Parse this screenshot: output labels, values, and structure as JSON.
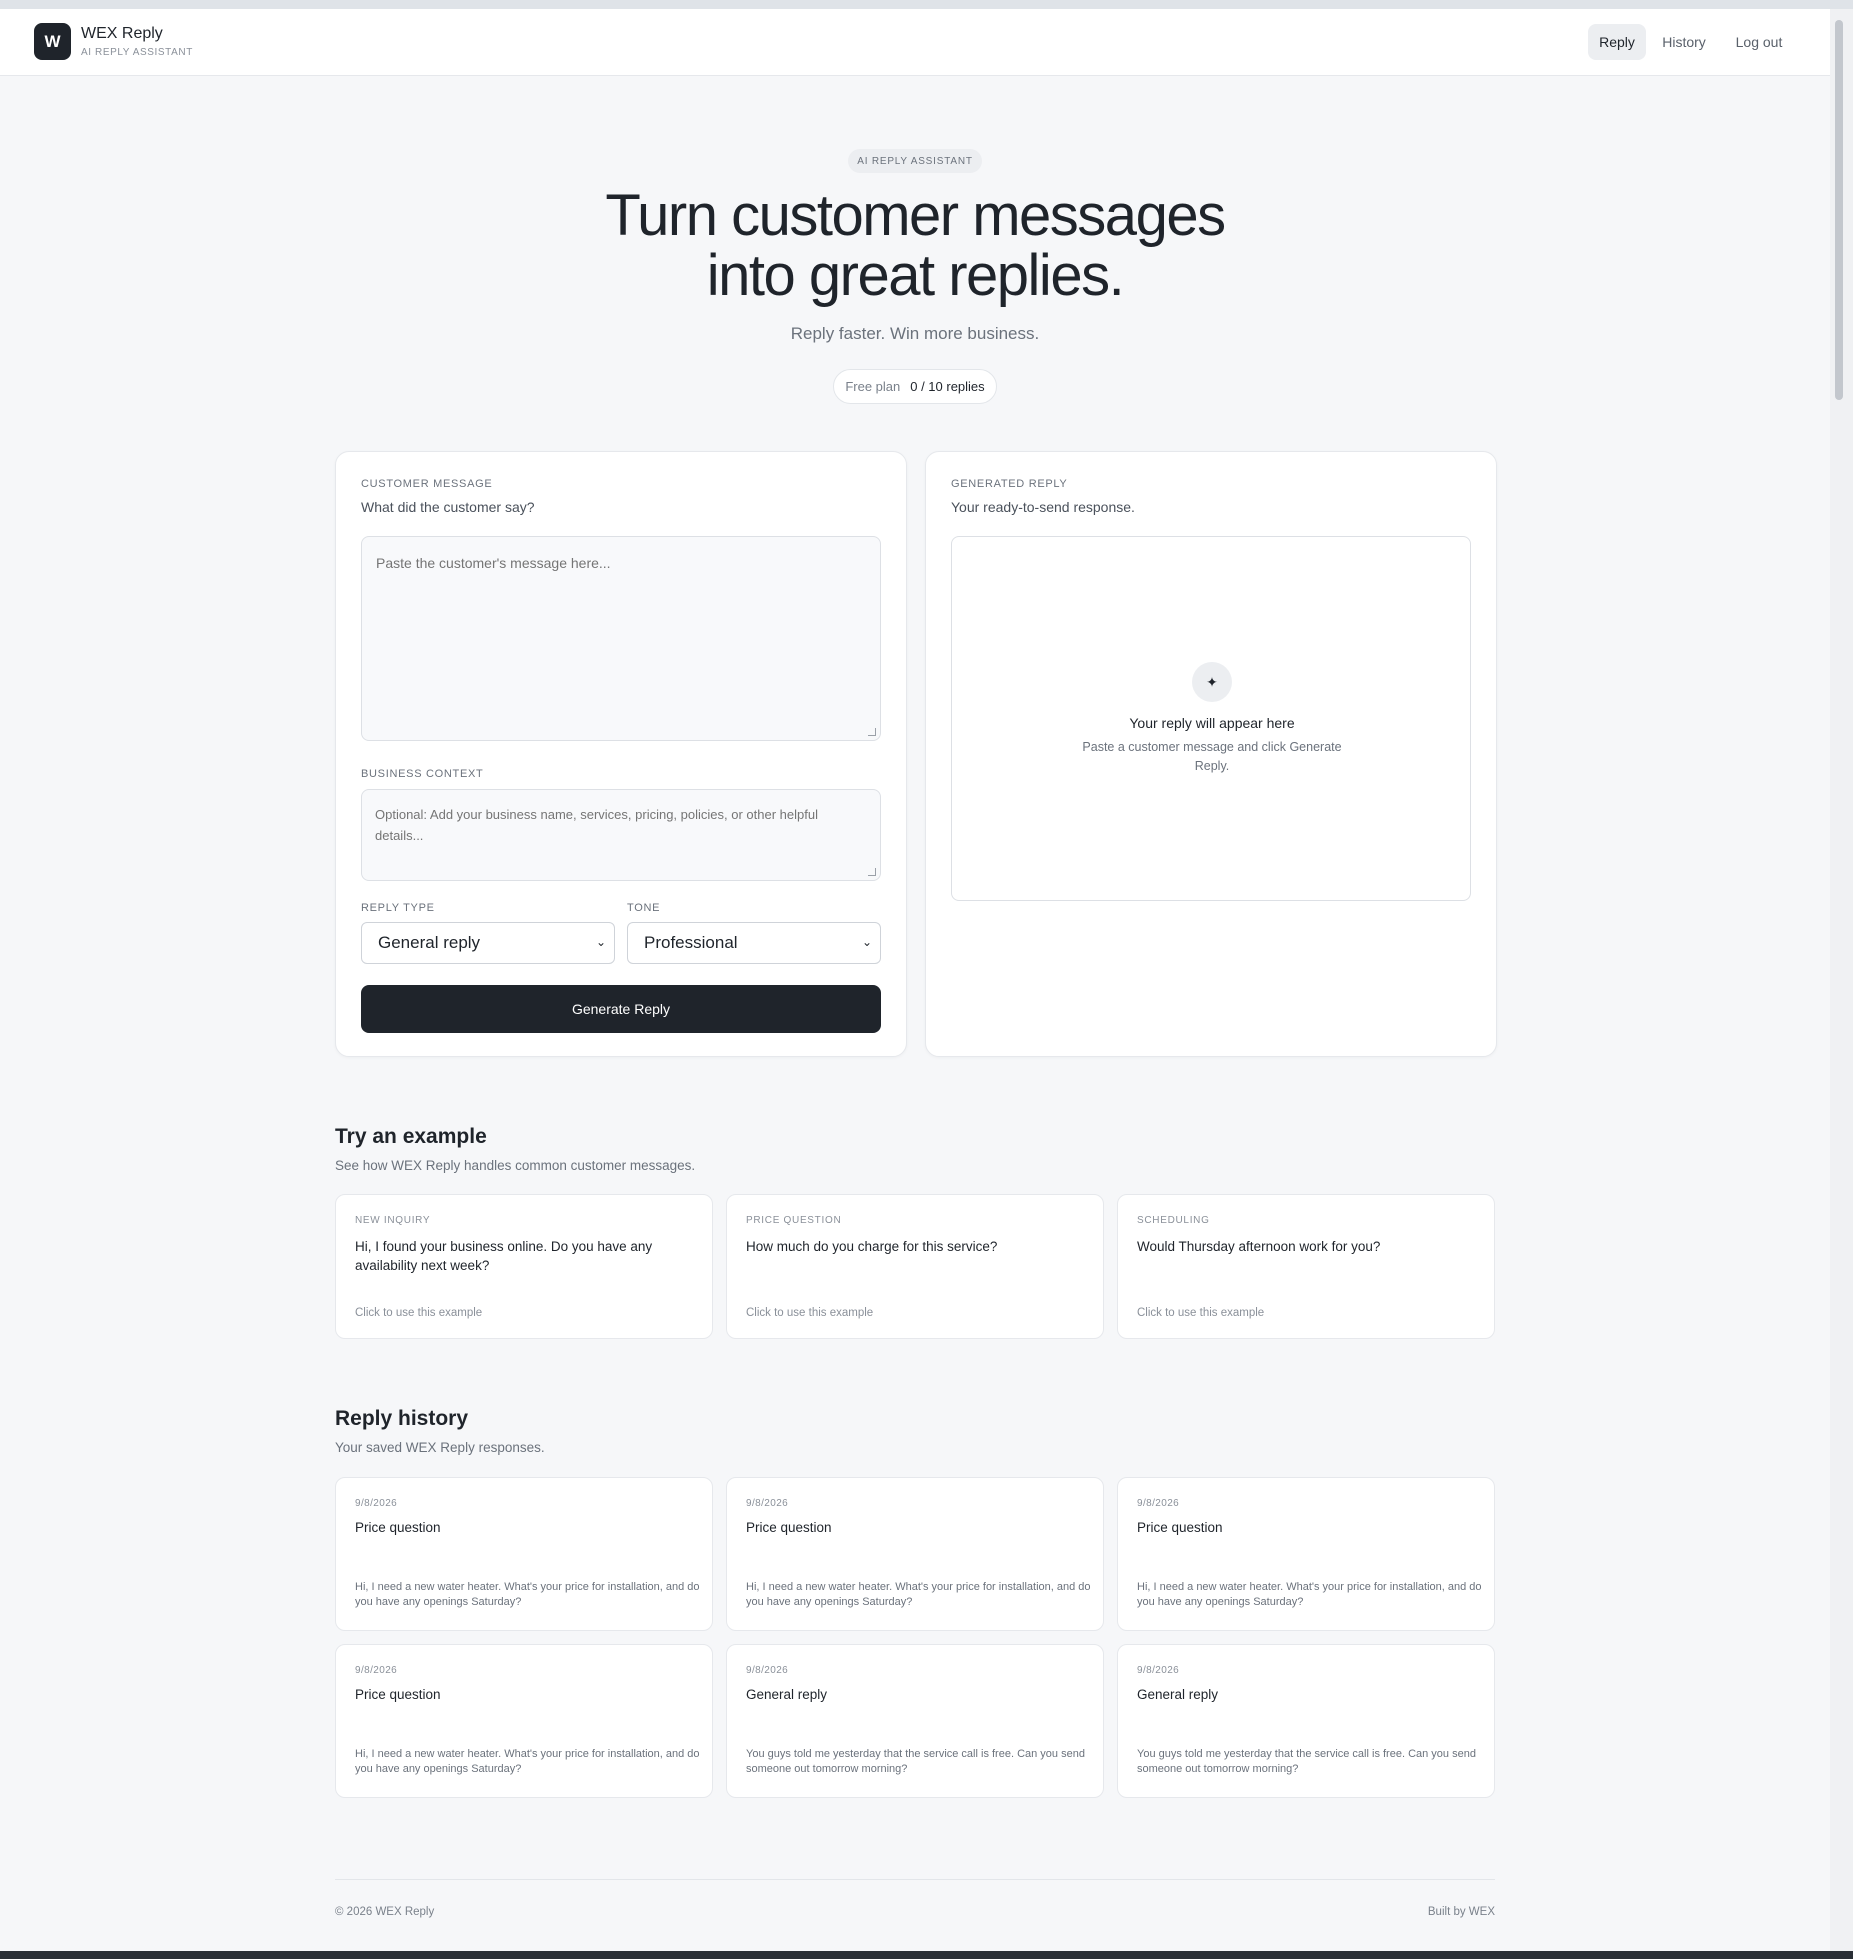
{
  "nav": {
    "logo_letter": "W",
    "brand_name": "WEX Reply",
    "brand_tagline": "AI REPLY ASSISTANT",
    "items": [
      {
        "label": "Reply",
        "active": true
      },
      {
        "label": "History",
        "active": false
      },
      {
        "label": "Log out",
        "active": false
      }
    ]
  },
  "hero": {
    "badge": "AI REPLY ASSISTANT",
    "title_line1": "Turn customer messages",
    "title_line2": "into great replies.",
    "subtitle": "Reply faster. Win more business.",
    "plan_label": "Free plan",
    "plan_count": "0 / 10 replies"
  },
  "composer": {
    "section_label": "CUSTOMER MESSAGE",
    "section_help": "What did the customer say?",
    "message_placeholder": "Paste the customer's message here...",
    "context_label": "BUSINESS CONTEXT",
    "context_placeholder": "Optional: Add your business name, services, pricing, policies, or other helpful details...",
    "reply_type_label": "REPLY TYPE",
    "reply_type_value": "General reply",
    "tone_label": "TONE",
    "tone_value": "Professional",
    "generate_label": "Generate Reply"
  },
  "output": {
    "section_label": "GENERATED REPLY",
    "section_help": "Your ready-to-send response.",
    "icon": "sparkle-icon",
    "empty_title": "Your reply will appear here",
    "empty_sub": "Paste a customer message and click Generate Reply."
  },
  "examples": {
    "title": "Try an example",
    "subtitle": "See how WEX Reply handles common customer messages.",
    "items": [
      {
        "tag": "NEW INQUIRY",
        "text": "Hi, I found your business online. Do you have any availability next week?",
        "hint": "Click to use this example"
      },
      {
        "tag": "PRICE QUESTION",
        "text": "How much do you charge for this service?",
        "hint": "Click to use this example"
      },
      {
        "tag": "SCHEDULING",
        "text": "Would Thursday afternoon work for you?",
        "hint": "Click to use this example"
      }
    ]
  },
  "history": {
    "title": "Reply history",
    "subtitle": "Your saved WEX Reply responses.",
    "items": [
      {
        "date": "9/8/2026",
        "type": "Price question",
        "message": "Hi, I need a new water heater. What's your price for installation, and do you have any openings Saturday?"
      },
      {
        "date": "9/8/2026",
        "type": "Price question",
        "message": "Hi, I need a new water heater. What's your price for installation, and do you have any openings Saturday?"
      },
      {
        "date": "9/8/2026",
        "type": "Price question",
        "message": "Hi, I need a new water heater. What's your price for installation, and do you have any openings Saturday?"
      },
      {
        "date": "9/8/2026",
        "type": "Price question",
        "message": "Hi, I need a new water heater. What's your price for installation, and do you have any openings Saturday?"
      },
      {
        "date": "9/8/2026",
        "type": "General reply",
        "message": "You guys told me yesterday that the service call is free. Can you send someone out tomorrow morning?"
      },
      {
        "date": "9/8/2026",
        "type": "General reply",
        "message": "You guys told me yesterday that the service call is free. Can you send someone out tomorrow morning?"
      }
    ]
  },
  "footer": {
    "left": "© 2026 WEX Reply",
    "right": "Built by WEX"
  },
  "colors": {
    "accent": "#1f242b",
    "background": "#f6f7f9"
  }
}
